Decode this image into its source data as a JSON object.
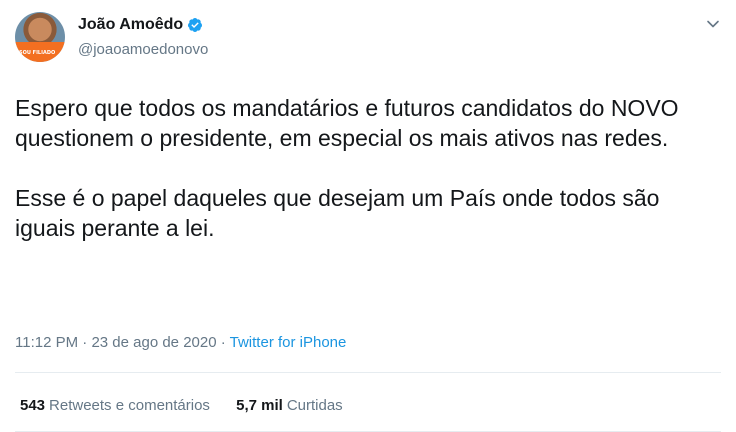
{
  "user": {
    "name": "João Amoêdo",
    "handle": "@joaoamoedonovo",
    "verified": true,
    "avatar_badge_text": "SOU FILIADO"
  },
  "tweet": {
    "paragraphs": [
      "Espero que todos os mandatários e futuros candidatos do NOVO questionem o presidente, em especial os mais ativos nas redes.",
      "Esse é o papel daqueles que desejam um País onde todos são iguais perante a lei."
    ],
    "time": "11:12 PM",
    "separator": "·",
    "date": "23 de ago de 2020",
    "source": "Twitter for iPhone"
  },
  "stats": {
    "retweets_count": "543",
    "retweets_label": "Retweets e comentários",
    "likes_count": "5,7 mil",
    "likes_label": "Curtidas"
  },
  "colors": {
    "text": "#14171a",
    "secondary": "#657786",
    "link": "#1b95e0",
    "verified": "#1da1f2",
    "divider": "#e6ecf0"
  },
  "icons": {
    "verified": "verified-badge-icon",
    "caret": "chevron-down-icon"
  }
}
